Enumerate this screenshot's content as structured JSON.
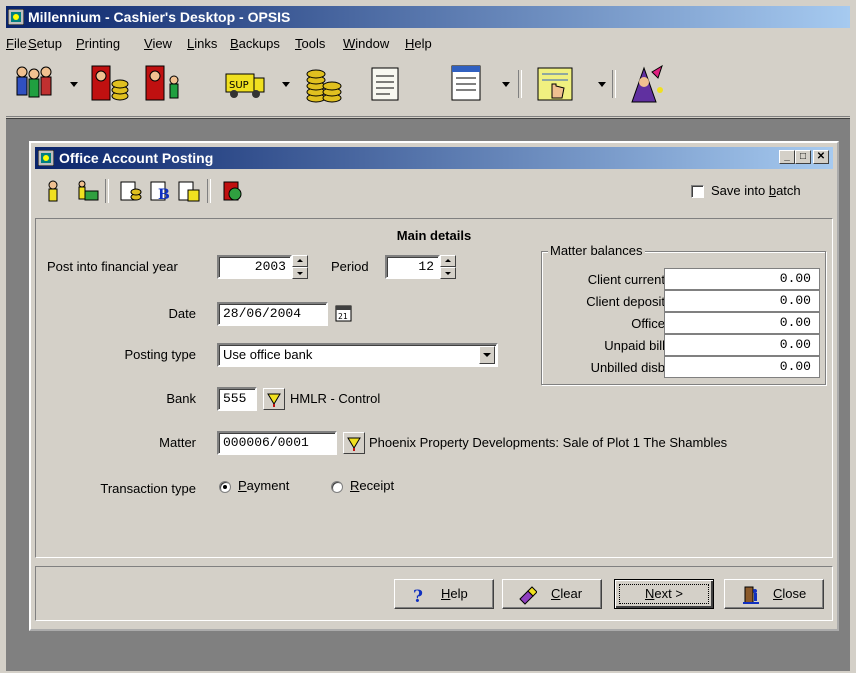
{
  "app": {
    "title": "Millennium - Cashier's Desktop - OPSIS",
    "menu": [
      {
        "label": "File",
        "u": "F",
        "rest": "ile"
      },
      {
        "label": "Setup",
        "u": "S",
        "rest": "etup"
      },
      {
        "label": "Printing",
        "u": "P",
        "rest": "rinting"
      },
      {
        "label": "View",
        "u": "V",
        "rest": "iew"
      },
      {
        "label": "Links",
        "u": "L",
        "rest": "inks"
      },
      {
        "label": "Backups",
        "u": "B",
        "rest": "ackups"
      },
      {
        "label": "Tools",
        "u": "T",
        "rest": "ools"
      },
      {
        "label": "Window",
        "u": "W",
        "rest": "indow"
      },
      {
        "label": "Help",
        "u": "H",
        "rest": "elp"
      }
    ],
    "toolbar_icons": [
      "clients-icon",
      "cashier-money-icon",
      "cashier-person-icon",
      "supplier-truck-icon",
      "coins-icon",
      "scroll-document-icon",
      "form-document-icon",
      "hand-pointer-icon",
      "wizard-icon"
    ]
  },
  "window": {
    "title": "Office Account Posting",
    "toolbar_icons": [
      "person-icon",
      "money-icon",
      "ledger-icon",
      "bold-ledger-icon",
      "ledger-calendar-icon",
      "posting-arrow-icon"
    ],
    "save_into_batch": {
      "label": "Save into ",
      "u": "b",
      "rest": "atch",
      "checked": false
    }
  },
  "main": {
    "section_title": "Main details",
    "financial_year": {
      "label": "Post into financial year",
      "value": "2003"
    },
    "period": {
      "label": "Period",
      "value": "12"
    },
    "date": {
      "label": "Date",
      "value": "28/06/2004"
    },
    "posting_type": {
      "label": "Posting type",
      "value": "Use office bank"
    },
    "bank": {
      "label": "Bank",
      "code": "555",
      "name": "HMLR - Control"
    },
    "matter": {
      "label": "Matter",
      "code": "000006/0001",
      "description": "Phoenix Property Developments: Sale of Plot 1 The Shambles"
    },
    "transaction_type": {
      "label": "Transaction type",
      "options": [
        {
          "u": "P",
          "rest": "ayment",
          "selected": true
        },
        {
          "u": "R",
          "rest": "eceipt",
          "selected": false
        }
      ]
    }
  },
  "balances": {
    "title": "Matter balances",
    "rows": [
      {
        "label": "Client current",
        "value": "0.00"
      },
      {
        "label": "Client deposit",
        "value": "0.00"
      },
      {
        "label": "Office",
        "value": "0.00"
      },
      {
        "label": "Unpaid bill",
        "value": "0.00"
      },
      {
        "label": "Unbilled disb",
        "value": "0.00"
      }
    ]
  },
  "buttons": {
    "help": {
      "u": "H",
      "rest": "elp"
    },
    "clear": {
      "u": "C",
      "rest": "lear"
    },
    "next": {
      "u": "N",
      "rest": "ext >"
    },
    "close": {
      "u": "C",
      "rest": "lose"
    }
  },
  "colors": {
    "title_bar": "#0a246a",
    "face": "#d4d0c8",
    "mdi_bg": "#808080"
  }
}
